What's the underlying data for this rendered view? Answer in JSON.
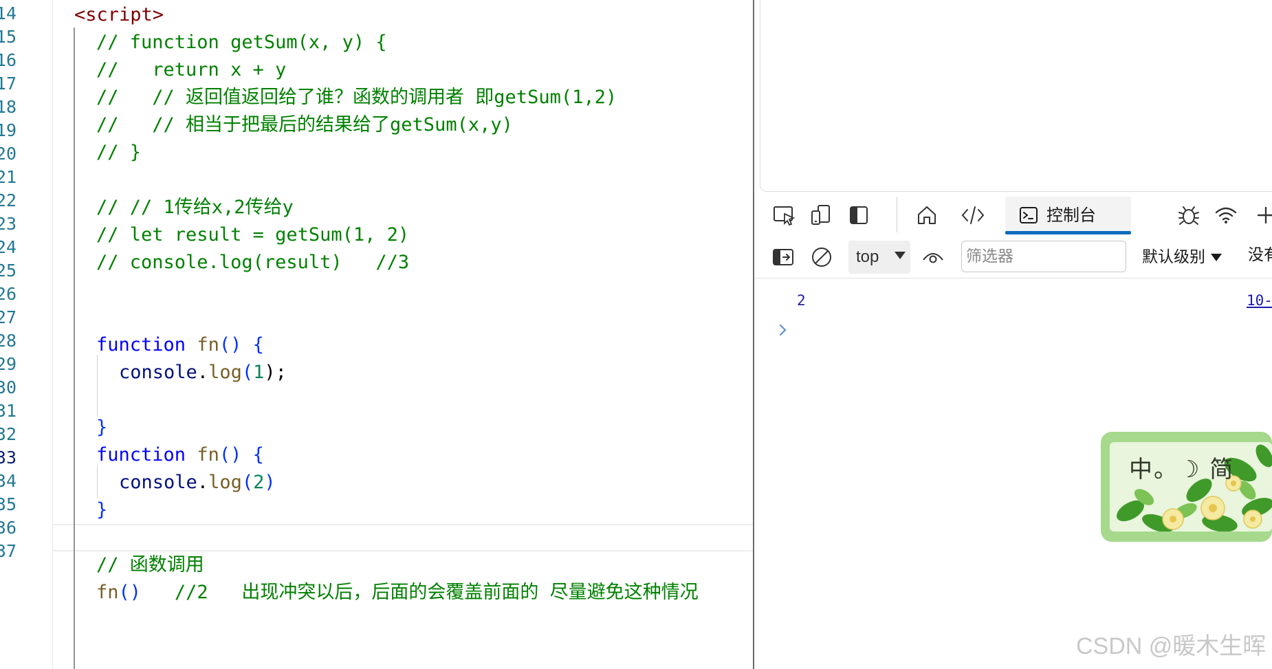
{
  "editor": {
    "line_numbers": [
      "14",
      "15",
      "16",
      "17",
      "18",
      "19",
      "20",
      "21",
      "22",
      "23",
      "24",
      "25",
      "26",
      "27",
      "28",
      "29",
      "30",
      "31",
      "32",
      "33",
      "34",
      "35",
      "36",
      "37"
    ],
    "lines": {
      "l14": "<script>",
      "l15": "// function getSum(x, y) {",
      "l16": "//   return x + y",
      "l17": "//   // 返回值返回给了谁？函数的调用者 即getSum(1,2)",
      "l18": "//   // 相当于把最后的结果给了getSum(x,y)",
      "l19": "// }",
      "l21": "// // 1传给x,2传给y",
      "l22": "// let result = getSum(1, 2)",
      "l23": "// console.log(result)   //3",
      "l26_kw": "function",
      "l26_fn": "fn",
      "l26_punc": "()",
      "l26_brace": "{",
      "l27_obj": "console",
      "l27_dot": ".",
      "l27_fn": "log",
      "l27_open": "(",
      "l27_arg": "1",
      "l27_close": ");",
      "l29_brace": "}",
      "l30_kw": "function",
      "l30_fn": "fn",
      "l30_punc": "()",
      "l30_brace": "{",
      "l31_obj": "console",
      "l31_dot": ".",
      "l31_fn": "log",
      "l31_open": "(",
      "l31_arg": "2",
      "l31_close": ")",
      "l32_brace": "}",
      "l34": "// 函数调用",
      "l35_fn": "fn",
      "l35_punc": "()",
      "l35_comment": "//2   出现冲突以后，后面的会覆盖前面的 尽量避免这种情况"
    }
  },
  "devtools": {
    "tabs": {
      "inspect_icon": "inspect-icon",
      "device_icon": "device-emulation-icon",
      "dock_icon": "dock-sidebar-icon",
      "welcome_icon": "home-icon",
      "elements_icon": "code-icon",
      "console_label": "控制台",
      "sources_icon": "bug-icon",
      "network_icon": "wifi-icon",
      "more_icon": "plus-icon"
    },
    "console_toolbar": {
      "context": "top",
      "filter_placeholder": "筛选器",
      "levels": "默认级别",
      "overflow": "没有"
    },
    "console": {
      "value": "2",
      "source": "10-"
    },
    "accent": "#0f6cbd"
  },
  "ime": {
    "status": "中。☽ 简"
  },
  "watermark": "CSDN @暖木生晖"
}
